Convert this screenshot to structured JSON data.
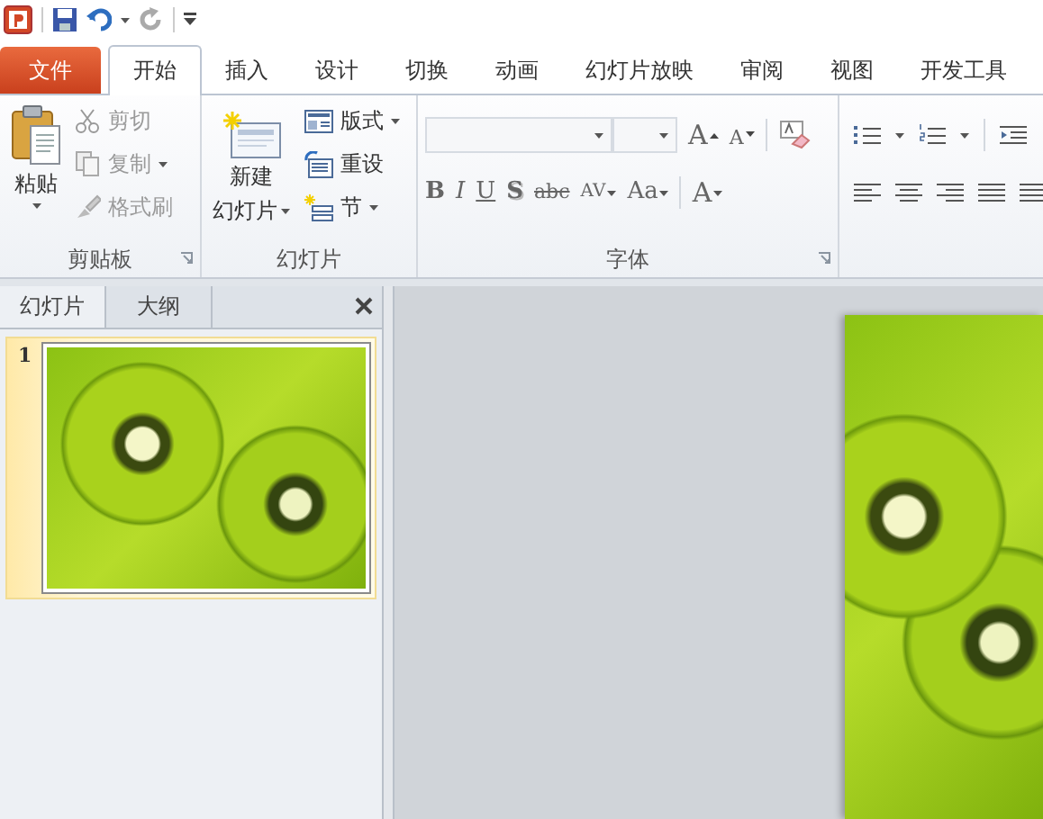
{
  "tabs": [
    {
      "label": "文件",
      "kind": "file",
      "selected": false
    },
    {
      "label": "开始",
      "kind": "tab",
      "selected": true
    },
    {
      "label": "插入",
      "kind": "tab",
      "selected": false
    },
    {
      "label": "设计",
      "kind": "tab",
      "selected": false
    },
    {
      "label": "切换",
      "kind": "tab",
      "selected": false
    },
    {
      "label": "动画",
      "kind": "tab",
      "selected": false
    },
    {
      "label": "幻灯片放映",
      "kind": "tab",
      "selected": false
    },
    {
      "label": "审阅",
      "kind": "tab",
      "selected": false
    },
    {
      "label": "视图",
      "kind": "tab",
      "selected": false
    },
    {
      "label": "开发工具",
      "kind": "tab",
      "selected": false
    }
  ],
  "clipboard": {
    "title": "剪贴板",
    "paste": "粘贴",
    "commands": [
      {
        "label": "剪切",
        "kind": "cut",
        "disabled": true,
        "dropdown": false
      },
      {
        "label": "复制",
        "kind": "copy",
        "disabled": true,
        "dropdown": true
      },
      {
        "label": "格式刷",
        "kind": "brush",
        "disabled": true,
        "dropdown": false
      }
    ]
  },
  "slides_group": {
    "title": "幻灯片",
    "new_slide": [
      "新建",
      "幻灯片"
    ],
    "commands": [
      {
        "label": "版式",
        "kind": "layout",
        "dropdown": true
      },
      {
        "label": "重设",
        "kind": "reset",
        "dropdown": false
      },
      {
        "label": "节",
        "kind": "section",
        "dropdown": true
      }
    ]
  },
  "font": {
    "title": "字体",
    "size_buttons": [
      {
        "label": "A",
        "kind": "grow"
      },
      {
        "label": "A",
        "kind": "shrink"
      }
    ],
    "format_buttons": [
      {
        "label": "B",
        "kind": "bold",
        "dropdown": false
      },
      {
        "label": "I",
        "kind": "italic",
        "dropdown": false
      },
      {
        "label": "U",
        "kind": "underline",
        "dropdown": false
      },
      {
        "label": "S",
        "kind": "shadow",
        "dropdown": false
      },
      {
        "label": "abc",
        "kind": "strike",
        "dropdown": false
      },
      {
        "label": "AV",
        "kind": "spacing",
        "dropdown": true
      },
      {
        "label": "Aa",
        "kind": "case",
        "dropdown": true
      },
      {
        "label": "A",
        "kind": "color",
        "dropdown": true
      }
    ]
  },
  "side_panel": {
    "tabs": [
      {
        "label": "幻灯片",
        "selected": true
      },
      {
        "label": "大纲",
        "selected": false
      }
    ],
    "slides": [
      {
        "number": "1",
        "selected": true
      }
    ]
  }
}
